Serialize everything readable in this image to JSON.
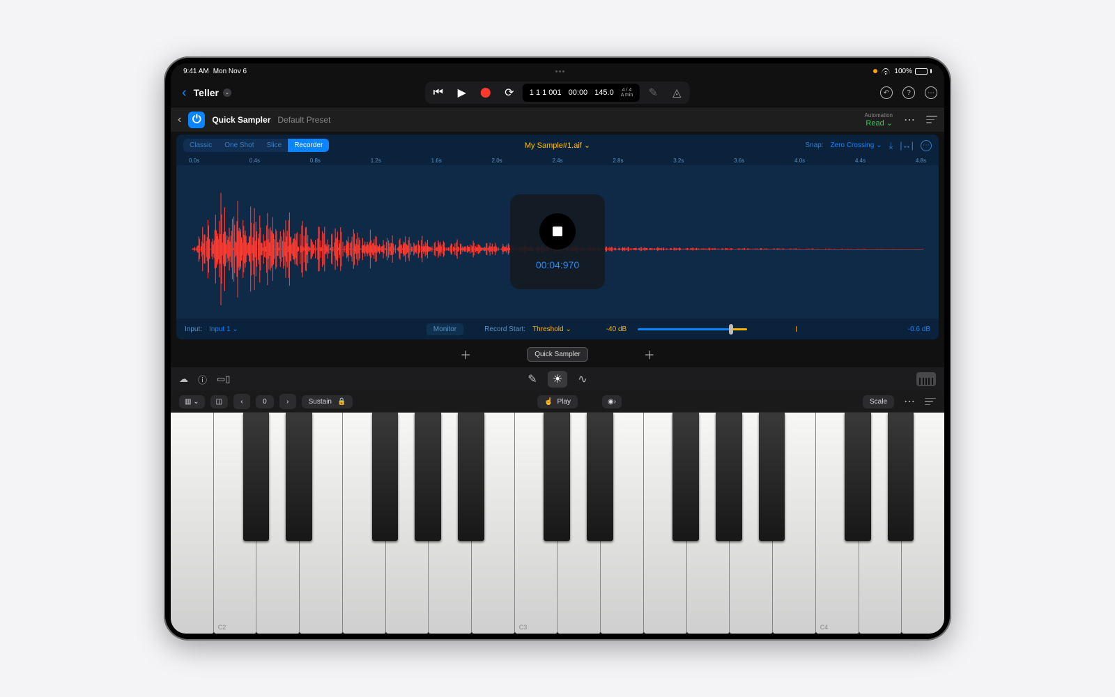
{
  "status": {
    "time": "9:41 AM",
    "date": "Mon Nov 6",
    "battery_pct": "100%"
  },
  "topbar": {
    "project": "Teller",
    "lcd_bars": "1 1 1 001",
    "lcd_time": "00:00",
    "lcd_tempo": "145.0",
    "tsig_top": "4 / 4",
    "tsig_bot": "A min"
  },
  "plugin": {
    "name": "Quick Sampler",
    "preset": "Default Preset",
    "automation_label": "Automation",
    "automation_mode": "Read"
  },
  "sampler": {
    "modes": {
      "classic": "Classic",
      "oneshot": "One Shot",
      "slice": "Slice",
      "recorder": "Recorder"
    },
    "sample_name": "My Sample#1.aif",
    "snap_label": "Snap:",
    "snap_value": "Zero Crossing",
    "ruler": [
      "0.0s",
      "0.4s",
      "0.8s",
      "1.2s",
      "1.6s",
      "2.0s",
      "2.4s",
      "2.8s",
      "3.2s",
      "3.6s",
      "4.0s",
      "4.4s",
      "4.8s"
    ],
    "rec_time": "00:04:970",
    "input_label": "Input:",
    "input_value": "Input 1",
    "monitor": "Monitor",
    "recstart_label": "Record Start:",
    "recstart_value": "Threshold",
    "db_thresh": "-40 dB",
    "db_peak": "-0.6 dB"
  },
  "trackstrip": {
    "chip": "Quick Sampler"
  },
  "kbctrl": {
    "octave": "0",
    "sustain": "Sustain",
    "play": "Play",
    "scale": "Scale"
  },
  "keylabels": {
    "c2": "C2",
    "c3": "C3",
    "c4": "C4"
  }
}
